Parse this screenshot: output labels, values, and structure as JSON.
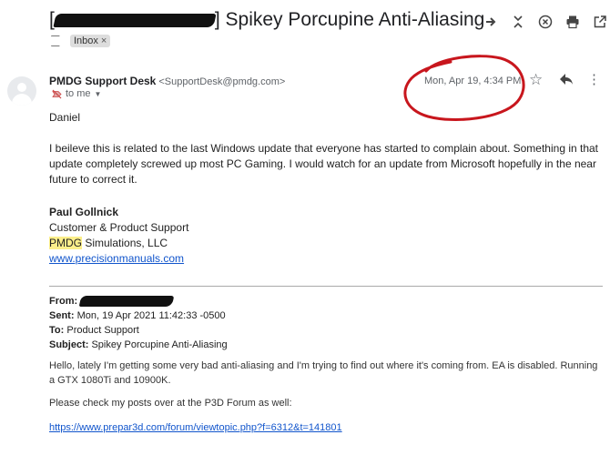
{
  "header": {
    "subject_open": "[",
    "subject_close": "]",
    "subject_text": "Spikey Porcupine Anti-Aliasing",
    "label_chip": "Inbox",
    "label_chip_close": "×"
  },
  "toolbar_icons": [
    "forward-arrow-icon",
    "collapse-icon",
    "close-circle-icon",
    "print-icon",
    "open-external-icon"
  ],
  "message": {
    "sender_name": "PMDG Support Desk",
    "sender_email": "<SupportDesk@pmdg.com>",
    "recipient": "to me",
    "date": "Mon, Apr 19, 4:34 PM",
    "greeting": "Daniel",
    "paragraph": "I beileve this is related to the last Windows update that everyone has started to complain about.  Something in that update completely screwed up most PC Gaming.  I would watch for an update from Microsoft hopefully in the near future to correct it.",
    "signature": {
      "name": "Paul Gollnick",
      "title": "Customer & Product Support",
      "company_highlight": "PMDG",
      "company_rest": " Simulations, LLC",
      "website": "www.precisionmanuals.com"
    }
  },
  "forwarded": {
    "from_label": "From:",
    "sent_label": "Sent:",
    "sent_value": "Mon, 19 Apr 2021 11:42:33 -0500",
    "to_label": "To:",
    "to_value": "Product Support",
    "subject_label": "Subject:",
    "subject_value": "Spikey Porcupine Anti-Aliasing",
    "body_1": "Hello, lately I'm getting some very bad anti-aliasing and I'm trying to find out where it's coming from. EA is disabled. Running a GTX 1080Ti and 10900K.",
    "body_2": "Please check my posts over at the P3D Forum as well:",
    "link": "https://www.prepar3d.com/forum/viewtopic.php?f=6312&t=141801"
  },
  "colors": {
    "annotation_circle": "#c8161d",
    "link": "#1155cc",
    "highlight": "#fcef8b"
  }
}
